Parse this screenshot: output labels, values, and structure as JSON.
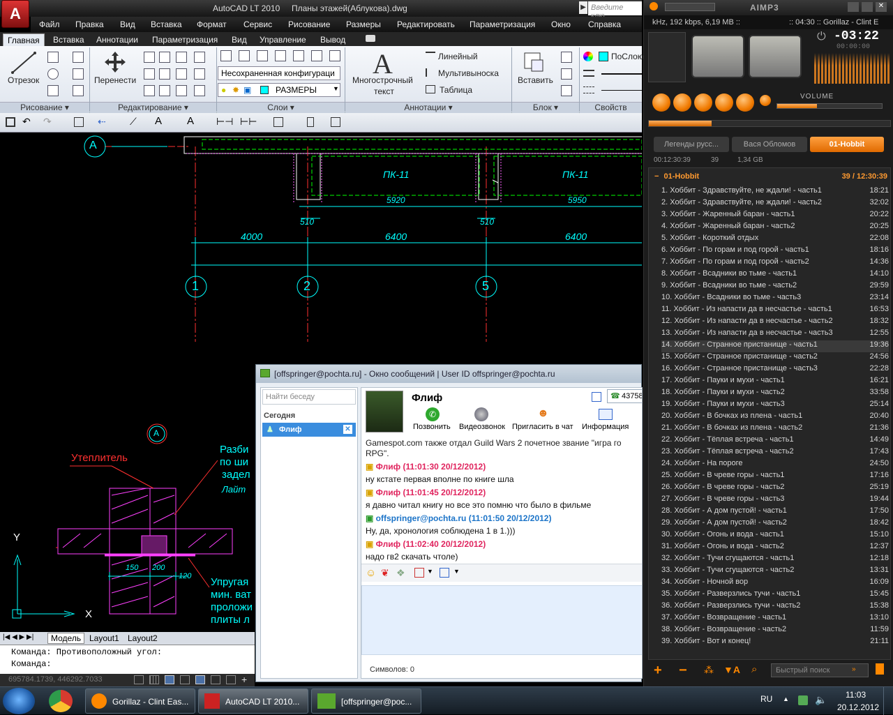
{
  "acad": {
    "title": "AutoCAD LT 2010",
    "filename": "Планы этажей(Аблукова).dwg",
    "search_placeholder": "Введите клю",
    "logo_letter": "A",
    "menu": [
      "Файл",
      "Правка",
      "Вид",
      "Вставка",
      "Формат",
      "Сервис",
      "Рисование",
      "Размеры",
      "Редактировать",
      "Параметризация",
      "Окно",
      "Справка"
    ],
    "tabs": [
      "Главная",
      "Вставка",
      "Аннотации",
      "Параметризация",
      "Вид",
      "Управление",
      "Вывод"
    ],
    "panels": {
      "draw": "Рисование",
      "modify": "Редактирование",
      "layers": "Слои",
      "annotation": "Аннотации",
      "block": "Блок",
      "properties": "Свойств"
    },
    "buttons": {
      "line": "Отрезок",
      "move": "Перенести",
      "mtext_1": "Многострочный",
      "mtext_2": "текст",
      "linear": "Линейный",
      "multileader": "Мультивыноска",
      "table": "Таблица",
      "insert": "Вставить",
      "bylayer": "ПоСлою"
    },
    "layer_config": "Несохраненная конфигураци",
    "layer_current": "РАЗМЕРЫ",
    "drawing": {
      "labels_pk": [
        "ПК-11",
        "ПК-11"
      ],
      "dims_top": [
        "5920",
        "5950"
      ],
      "dims_small": [
        "510",
        "510"
      ],
      "dims_main": [
        "4000",
        "6400",
        "6400"
      ],
      "axes": [
        "1",
        "2",
        "5"
      ],
      "axis_a": "А",
      "callout_a": "A",
      "note_insulation": "Утеплитель",
      "note_right_1": "Разби",
      "note_right_2": "по ши",
      "note_right_3": "задел",
      "note_right_4": "Лайт",
      "note_elastic_1": "Упругая",
      "note_elastic_2": "мин. ват",
      "note_elastic_3": "проложи",
      "note_elastic_4": "плиты л",
      "dim_150": "150",
      "dim_200": "200",
      "dim_120": "120",
      "ucs_x": "X",
      "ucs_y": "Y"
    },
    "layout_tabs": [
      "Модель",
      "Layout1",
      "Layout2"
    ],
    "command_lines": [
      "Команда: Противоположный угол:",
      "Команда:"
    ],
    "coords": "695784.1739, 446292.7033"
  },
  "messenger": {
    "title": "[offspringer@pochta.ru] - Окно сообщений | User ID offspringer@pochta.ru",
    "search_placeholder": "Найти беседу",
    "group_label": "Сегодня",
    "contact": "Флиф",
    "contact_name": "Флиф",
    "counter": "43758",
    "actions": [
      "Позвонить",
      "Видеозвонок",
      "Пригласить в чат",
      "Информация"
    ],
    "partial_line_1": "Gamespot.com также отдал Guild Wars 2 почетное звание \"игра го",
    "partial_line_2": "RPG\".",
    "messages": [
      {
        "sender": "Флиф (11:01:30 20/12/2012)",
        "text": "ну кстате первая вполне по книге шла",
        "self": false
      },
      {
        "sender": "Флиф (11:01:45 20/12/2012)",
        "text": "я давно читал книгу но все это помню что было в фильме",
        "self": false
      },
      {
        "sender": "offspringer@pochta.ru (11:01:50 20/12/2012)",
        "text": "Ну, да, хронология соблюдена 1 в 1.)))",
        "self": true
      },
      {
        "sender": "Флиф (11:02:40 20/12/2012)",
        "text": "надо гв2 скачать чтоле)",
        "self": false
      }
    ],
    "char_count_label": "Символов:",
    "char_count": "0"
  },
  "aimp": {
    "logo": "AIMP3",
    "info": "kHz, 192 kbps, 6,19 MB ::",
    "now_playing": ":: 04:30 :: Gorillaz - Clint E",
    "time": "-03:22",
    "time_sub": "00:00:00",
    "volume_label": "VOLUME",
    "playlist_tabs": [
      "Легенды русс...",
      "Вася Обломов",
      "01-Hobbit"
    ],
    "playlist_stats": [
      "00:12:30:39",
      "39",
      "1,34 GB"
    ],
    "group": "01-Hobbit",
    "group_info": "39 / 12:30:39",
    "quick_search": "Быстрый поиск",
    "tracks": [
      [
        "1. Хоббит - Здравствуйте, не ждали! - часть1",
        "18:21"
      ],
      [
        "2. Хоббит - Здравствуйте, не ждали! - часть2",
        "32:02"
      ],
      [
        "3. Хоббит - Жаренный баран - часть1",
        "20:22"
      ],
      [
        "4. Хоббит - Жаренный баран - часть2",
        "20:25"
      ],
      [
        "5. Хоббит - Короткий отдых",
        "22:08"
      ],
      [
        "6. Хоббит - По горам и под горой - часть1",
        "18:16"
      ],
      [
        "7. Хоббит - По горам и под горой - часть2",
        "14:36"
      ],
      [
        "8. Хоббит - Всадники во тьме - часть1",
        "14:10"
      ],
      [
        "9. Хоббит - Всадники во тьме - часть2",
        "29:59"
      ],
      [
        "10. Хоббит - Всадники во тьме - часть3",
        "23:14"
      ],
      [
        "11. Хоббит - Из напасти да в несчастье - часть1",
        "16:53"
      ],
      [
        "12. Хоббит - Из напасти да в несчастье - часть2",
        "18:32"
      ],
      [
        "13. Хоббит - Из напасти да в несчастье - часть3",
        "12:55"
      ],
      [
        "14. Хоббит - Странное пристанище - часть1",
        "19:36"
      ],
      [
        "15. Хоббит - Странное пристанище - часть2",
        "24:56"
      ],
      [
        "16. Хоббит - Странное пристанище - часть3",
        "22:28"
      ],
      [
        "17. Хоббит - Пауки и мухи - часть1",
        "16:21"
      ],
      [
        "18. Хоббит - Пауки и мухи - часть2",
        "33:58"
      ],
      [
        "19. Хоббит - Пауки и мухи - часть3",
        "25:14"
      ],
      [
        "20. Хоббит - В бочках из плена - часть1",
        "20:40"
      ],
      [
        "21. Хоббит - В бочках из плена - часть2",
        "21:36"
      ],
      [
        "22. Хоббит - Тёплая встреча - часть1",
        "14:49"
      ],
      [
        "23. Хоббит - Тёплая встреча - часть2",
        "17:43"
      ],
      [
        "24. Хоббит - На пороге",
        "24:50"
      ],
      [
        "25. Хоббит - В чреве горы - часть1",
        "17:16"
      ],
      [
        "26. Хоббит - В чреве горы - часть2",
        "25:19"
      ],
      [
        "27. Хоббит - В чреве горы - часть3",
        "19:44"
      ],
      [
        "28. Хоббит - А дом пустой! - часть1",
        "17:50"
      ],
      [
        "29. Хоббит - А дом пустой! - часть2",
        "18:42"
      ],
      [
        "30. Хоббит - Огонь и вода - часть1",
        "15:10"
      ],
      [
        "31. Хоббит - Огонь и вода - часть2",
        "12:37"
      ],
      [
        "32. Хоббит - Тучи сгущаются - часть1",
        "12:18"
      ],
      [
        "33. Хоббит - Тучи сгущаются - часть2",
        "13:31"
      ],
      [
        "34. Хоббит - Ночной вор",
        "16:09"
      ],
      [
        "35. Хоббит - Разверзлись тучи - часть1",
        "15:45"
      ],
      [
        "36. Хоббит - Разверзлись тучи - часть2",
        "15:38"
      ],
      [
        "37. Хоббит - Возвращение - часть1",
        "13:10"
      ],
      [
        "38. Хоббит - Возвращение - часть2",
        "11:59"
      ],
      [
        "39. Хоббит - Вот и конец!",
        "21:11"
      ]
    ],
    "selected_index": 13
  },
  "taskbar": {
    "items": [
      "Gorillaz - Clint Eas...",
      "AutoCAD LT 2010...",
      "[offspringer@poc..."
    ],
    "lang": "RU",
    "time": "11:03",
    "date": "20.12.2012"
  },
  "colors": {
    "cad_cyan": "#00ffff",
    "cad_red": "#ff2020",
    "cad_magenta": "#ff40ff",
    "aimp_orange": "#f07a00",
    "flif_red": "#e0245e",
    "self_blue": "#1c74c8"
  }
}
